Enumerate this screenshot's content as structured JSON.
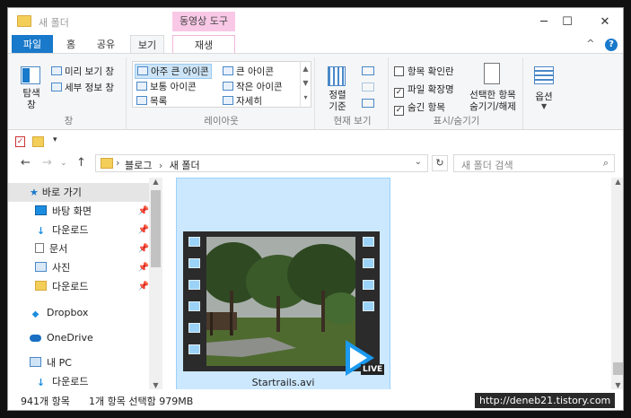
{
  "window": {
    "title": "새 폴더",
    "context_label": "동영상 도구",
    "minimize": "─",
    "maximize": "☐",
    "close": "✕"
  },
  "tabs": {
    "file": "파일",
    "home": "홈",
    "share": "공유",
    "view": "보기",
    "play": "재생",
    "collapse": "^",
    "help": "?"
  },
  "ribbon": {
    "pane_group": {
      "nav_pane": "탐색\n창",
      "preview": "미리 보기 창",
      "details": "세부 정보 창",
      "label": "창"
    },
    "layout_group": {
      "items": [
        "아주 큰 아이콘",
        "큰 아이콘",
        "보통 아이콘",
        "작은 아이콘",
        "목록",
        "자세히"
      ],
      "label": "레이아웃"
    },
    "current_view_group": {
      "sort": "정렬\n기준",
      "label": "현재 보기"
    },
    "showhide_group": {
      "checkboxes": [
        "항목 확인란",
        "파일 확장명",
        "숨긴 항목"
      ],
      "checked": [
        false,
        true,
        true
      ],
      "hide_selected": "선택한 항목\n숨기기/해제",
      "label": "표시/숨기기"
    },
    "options": "옵션"
  },
  "address": {
    "path_root": "블로그",
    "separator": "›",
    "path_current": "새 폴더",
    "search_placeholder": "새 폴더 검색"
  },
  "nav": {
    "quick_access": "바로 가기",
    "items": [
      {
        "label": "바탕 화면",
        "icon": "desktop-icon"
      },
      {
        "label": "다운로드",
        "icon": "download-icon"
      },
      {
        "label": "문서",
        "icon": "document-icon"
      },
      {
        "label": "사진",
        "icon": "pictures-icon"
      },
      {
        "label": "다운로드",
        "icon": "folder-icon"
      }
    ],
    "dropbox": "Dropbox",
    "onedrive": "OneDrive",
    "this_pc": "내 PC",
    "pc_downloads": "다운로드"
  },
  "file": {
    "name": "Startrails.avi",
    "badge": "LIVE"
  },
  "status": {
    "count": "941개 항목",
    "selected": "1개 항목 선택함 979MB",
    "watermark": "http://deneb21.tistory.com"
  },
  "colors": {
    "accent": "#1979ca",
    "context_tab": "#f9c8e6",
    "selection": "#cce8ff"
  }
}
